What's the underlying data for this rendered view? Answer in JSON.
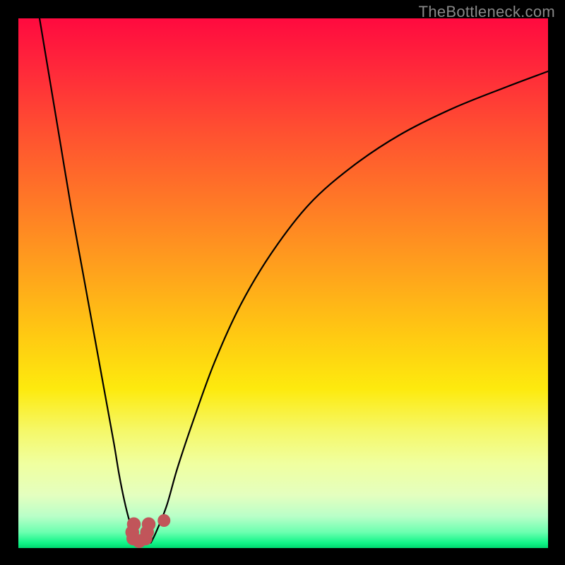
{
  "watermark": {
    "text": "TheBottleneck.com"
  },
  "colors": {
    "frame": "#000000",
    "curve": "#000000",
    "marker": "#c1555a",
    "gradient_top": "#ff0a3f",
    "gradient_bottom": "#00d870"
  },
  "chart_data": {
    "type": "line",
    "title": "",
    "xlabel": "",
    "ylabel": "",
    "xlim": [
      0,
      100
    ],
    "ylim": [
      0,
      100
    ],
    "grid": false,
    "legend": false,
    "series": [
      {
        "name": "left-curve",
        "x": [
          4,
          6,
          8,
          10,
          12,
          14,
          16,
          18,
          19,
          20,
          21,
          22,
          23
        ],
        "y": [
          100,
          88,
          76,
          64,
          53,
          42,
          31,
          20,
          14,
          9,
          5,
          2,
          1
        ]
      },
      {
        "name": "right-curve",
        "x": [
          25,
          26,
          28,
          30,
          33,
          37,
          42,
          48,
          55,
          63,
          72,
          82,
          92,
          100
        ],
        "y": [
          1,
          3,
          8,
          15,
          24,
          35,
          46,
          56,
          65,
          72,
          78,
          83,
          87,
          90
        ]
      }
    ],
    "markers": [
      {
        "name": "valley-left-top",
        "x": 21.8,
        "y": 4.5,
        "r": 1.3
      },
      {
        "name": "valley-left-mid",
        "x": 21.5,
        "y": 3.0,
        "r": 1.3
      },
      {
        "name": "valley-bottom-l",
        "x": 21.7,
        "y": 1.8,
        "r": 1.3
      },
      {
        "name": "valley-bottom-c",
        "x": 22.8,
        "y": 1.3,
        "r": 1.3
      },
      {
        "name": "valley-bottom-r",
        "x": 24.0,
        "y": 1.8,
        "r": 1.3
      },
      {
        "name": "valley-right-mid",
        "x": 24.3,
        "y": 3.0,
        "r": 1.3
      },
      {
        "name": "valley-right-top",
        "x": 24.6,
        "y": 4.5,
        "r": 1.3
      },
      {
        "name": "isolated-dot",
        "x": 27.5,
        "y": 5.2,
        "r": 1.2
      }
    ]
  }
}
